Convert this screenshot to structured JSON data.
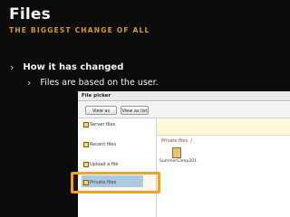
{
  "slide": {
    "title": "Files",
    "subtitle": "THE BIGGEST CHANGE OF ALL",
    "bullets": [
      {
        "chevron": "›",
        "text": "How it has changed"
      },
      {
        "chevron": "›",
        "text": "Files are based on the user."
      }
    ]
  },
  "picker": {
    "title": "File picker",
    "view_buttons": [
      "View as icons",
      "View as list"
    ],
    "repositories": [
      "Server files",
      "Recent files",
      "Upload a file",
      "Private files"
    ],
    "selected_repository": "Private files",
    "path": {
      "link": "Private files",
      "separator": "/"
    },
    "files": [
      {
        "name": "SummerCamp201",
        "icon": "folder-icon"
      }
    ]
  },
  "colors": {
    "background": "#0c0c0c",
    "accent": "#d59a2a",
    "highlight": "#e8a534",
    "selection": "#a8cdf2"
  }
}
